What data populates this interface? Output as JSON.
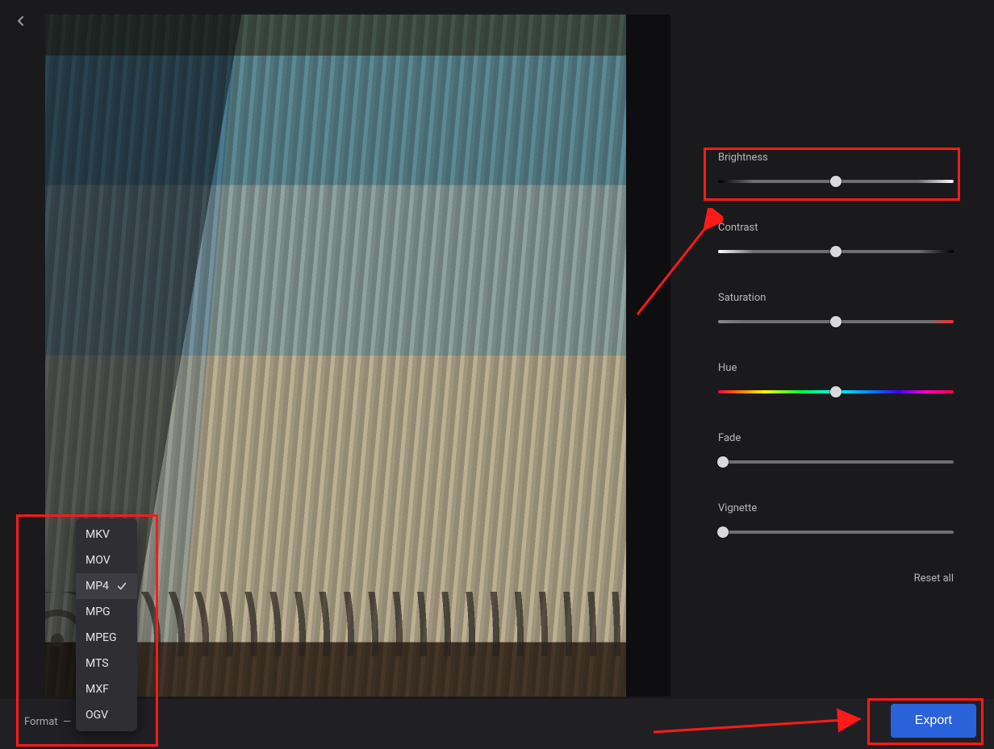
{
  "back_icon": "chevron-left",
  "sliders": [
    {
      "label": "Brightness",
      "type": "brightness",
      "position": 50
    },
    {
      "label": "Contrast",
      "type": "contrast",
      "position": 50
    },
    {
      "label": "Saturation",
      "type": "saturation",
      "position": 50
    },
    {
      "label": "Hue",
      "type": "hue",
      "position": 50
    },
    {
      "label": "Fade",
      "type": "plain",
      "position": 2
    },
    {
      "label": "Vignette",
      "type": "plain",
      "position": 2
    }
  ],
  "reset_label": "Reset all",
  "format_label": "Format",
  "formats": [
    "MKV",
    "MOV",
    "MP4",
    "MPG",
    "MPEG",
    "MTS",
    "MXF",
    "OGV"
  ],
  "selected_format": "MP4",
  "export_label": "Export"
}
